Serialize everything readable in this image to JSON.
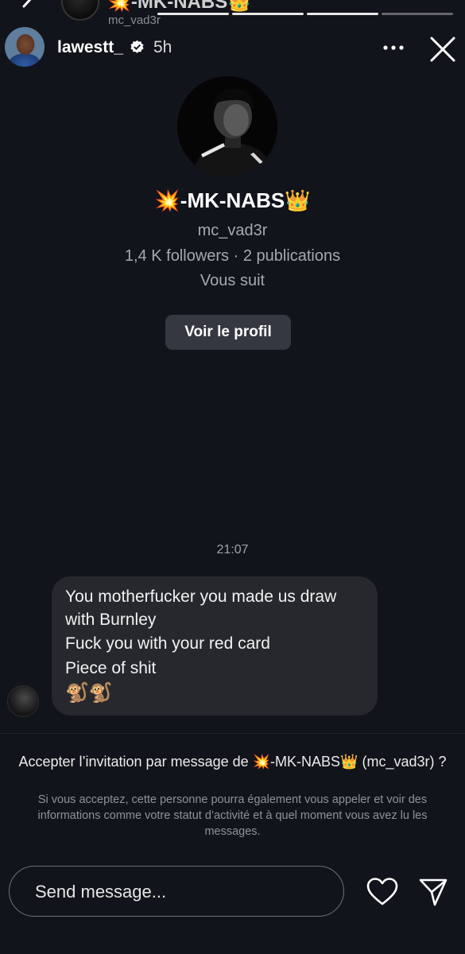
{
  "top_strip": {
    "display_name": "💥-MK-NABS👑",
    "handle": "mc_vad3r"
  },
  "story_header": {
    "username": "lawestt_",
    "time_ago": "5h",
    "icons": {
      "verified": "verified-badge-icon",
      "more": "more-options-icon",
      "close": "close-icon"
    }
  },
  "profile": {
    "display_name": "💥-MK-NABS👑",
    "handle": "mc_vad3r",
    "stats": "1,4 K followers · 2 publications",
    "follow_status": "Vous suit",
    "view_profile_label": "Voir le profil"
  },
  "conversation": {
    "timestamp": "21:07",
    "message_lines": [
      "You motherfucker you made us draw",
      "with Burnley",
      "Fuck you with your red card",
      "Piece of shit",
      "🐒🐒"
    ]
  },
  "invitation": {
    "title": "Accepter l’invitation par message de 💥-MK-NABS👑 (mc_vad3r) ?",
    "body": "Si vous acceptez, cette personne pourra également vous appeler et voir des informations comme votre statut d’activité et à quel moment vous avez lu les messages."
  },
  "composer": {
    "placeholder": "Send message...",
    "icons": {
      "like": "heart-icon",
      "send": "send-icon"
    }
  },
  "colors": {
    "background": "#11141a",
    "bubble": "#26282d",
    "button": "#353840",
    "secondary_text": "#a5a8ad"
  }
}
